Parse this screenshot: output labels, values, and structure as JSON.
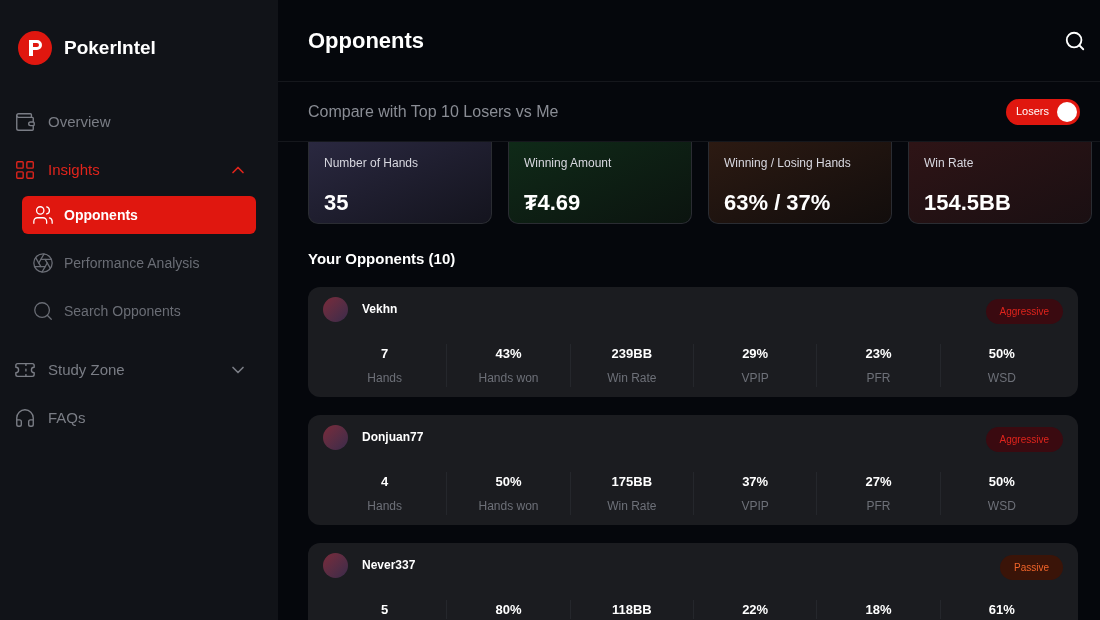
{
  "brand": {
    "name": "PokerIntel"
  },
  "nav": [
    {
      "label": "Overview",
      "selected": false
    },
    {
      "label": "Insights",
      "selected": true,
      "expanded": true,
      "children": [
        {
          "label": "Opponents",
          "selected": true
        },
        {
          "label": "Performance Analysis",
          "selected": false
        },
        {
          "label": "Search Opponents",
          "selected": false
        }
      ]
    },
    {
      "label": "Study Zone",
      "selected": false,
      "expanded": false
    },
    {
      "label": "FAQs",
      "selected": false
    }
  ],
  "header": {
    "title": "Opponents"
  },
  "compare": {
    "text": "Compare with Top 10 Losers vs Me",
    "toggle": {
      "label": "Losers",
      "on": true
    }
  },
  "stats": [
    {
      "label": "Number of Hands",
      "value": "35"
    },
    {
      "label": "Winning Amount",
      "value": "₮4.69"
    },
    {
      "label": "Winning / Losing Hands",
      "value": "63% / 37%"
    },
    {
      "label": "Win Rate",
      "value": "154.5BB"
    }
  ],
  "opponents_title": "Your Opponents (10)",
  "opponents": [
    {
      "name": "Vekhn",
      "tag": {
        "label": "Aggressive",
        "kind": "aggressive"
      },
      "stats": [
        {
          "value": "7",
          "label": "Hands"
        },
        {
          "value": "43%",
          "label": "Hands won"
        },
        {
          "value": "239BB",
          "label": "Win Rate"
        },
        {
          "value": "29%",
          "label": "VPIP"
        },
        {
          "value": "23%",
          "label": "PFR"
        },
        {
          "value": "50%",
          "label": "WSD"
        }
      ]
    },
    {
      "name": "Donjuan77",
      "tag": {
        "label": "Aggressive",
        "kind": "aggressive"
      },
      "stats": [
        {
          "value": "4",
          "label": "Hands"
        },
        {
          "value": "50%",
          "label": "Hands won"
        },
        {
          "value": "175BB",
          "label": "Win Rate"
        },
        {
          "value": "37%",
          "label": "VPIP"
        },
        {
          "value": "27%",
          "label": "PFR"
        },
        {
          "value": "50%",
          "label": "WSD"
        }
      ]
    },
    {
      "name": "Never337",
      "tag": {
        "label": "Passive",
        "kind": "passive"
      },
      "stats": [
        {
          "value": "5"
        },
        {
          "value": "80%"
        },
        {
          "value": "118BB"
        },
        {
          "value": "22%"
        },
        {
          "value": "18%"
        },
        {
          "value": "61%"
        }
      ]
    }
  ]
}
